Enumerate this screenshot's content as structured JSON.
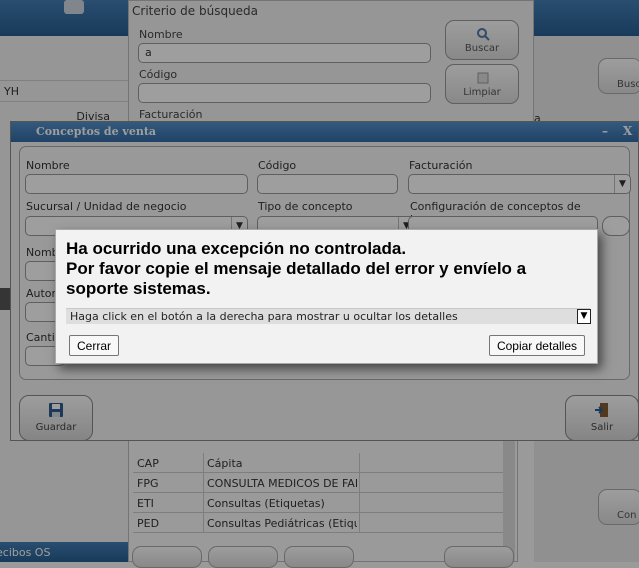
{
  "background": {
    "left_panel": {
      "rows": [
        "YH",
        "Divisa"
      ],
      "footer": "ecibos OS"
    },
    "search": {
      "title": "Criterio de búsqueda",
      "name_label": "Nombre",
      "name_value": "a",
      "code_label": "Código",
      "billing_label": "Facturación",
      "search_button": "Buscar",
      "clear_button": "Limpiar"
    },
    "right_panel": {
      "button1": "Busc",
      "button2": "Con",
      "letter": "a"
    },
    "table": {
      "rows": [
        {
          "code": "CAP",
          "name": "Cápita"
        },
        {
          "code": "FPG",
          "name": "CONSULTA MEDICOS DE FAMI"
        },
        {
          "code": "ETI",
          "name": "Consultas (Etiquetas)"
        },
        {
          "code": "PED",
          "name": "Consultas Pediátricas (Etiqueta"
        }
      ]
    }
  },
  "dialog": {
    "title": "Conceptos de venta",
    "minimize": "–",
    "close": "X",
    "fields": {
      "nombre": "Nombre",
      "codigo": "Código",
      "facturacion": "Facturación",
      "sucursal": "Sucursal / Unidad de negocio",
      "tipo_concepto": "Tipo de concepto",
      "config_ingresos": "Configuración de conceptos de ingresos",
      "nombre2": "Nomb",
      "autor": "Autor",
      "cantidad": "Cantid"
    },
    "save_button": "Guardar",
    "exit_button": "Salir"
  },
  "error": {
    "message_lines": [
      "Ha ocurrido una excepción no controlada.",
      "Por favor copie el mensaje detallado del error y envíelo a",
      "soporte sistemas."
    ],
    "details_hint": "Haga click en el botón a la derecha para mostrar u ocultar los detalles",
    "toggle_symbol": "▼",
    "close_button": "Cerrar",
    "copy_button": "Copiar detalles"
  }
}
